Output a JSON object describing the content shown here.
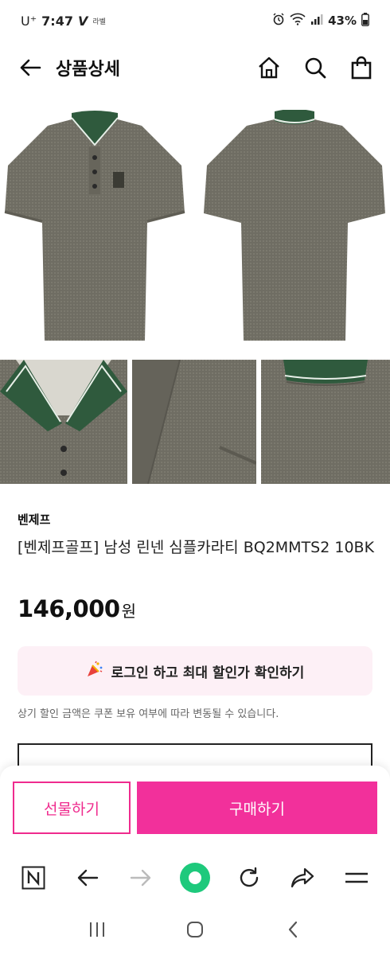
{
  "status_bar": {
    "carrier": "U⁺",
    "time": "7:47",
    "app_tag": "V",
    "app_tag_small": "라벨",
    "battery": "43%"
  },
  "header": {
    "title": "상품상세"
  },
  "product": {
    "brand": "벤제프",
    "name": "[벤제프골프] 남성 린넨 심플카라티 BQ2MMTS2 10BK",
    "price": "146,000",
    "currency": "원"
  },
  "promo": {
    "login_banner": "로그인 하고 최대 할인가 확인하기",
    "notice": "상기 할인 금액은 쿠폰 보유 여부에 따라 변동될 수 있습니다."
  },
  "buy_bar": {
    "gift_label": "선물하기",
    "buy_label": "구매하기"
  },
  "colors": {
    "accent": "#f2309b",
    "banner_bg": "#fdf0f6",
    "shirt_body": "#6f6d63",
    "collar": "#2f5a3d"
  },
  "icons": {
    "back": "arrow-left-icon",
    "home": "home-icon",
    "search": "search-icon",
    "cart": "shopping-bag-icon",
    "party": "party-popper-icon"
  }
}
